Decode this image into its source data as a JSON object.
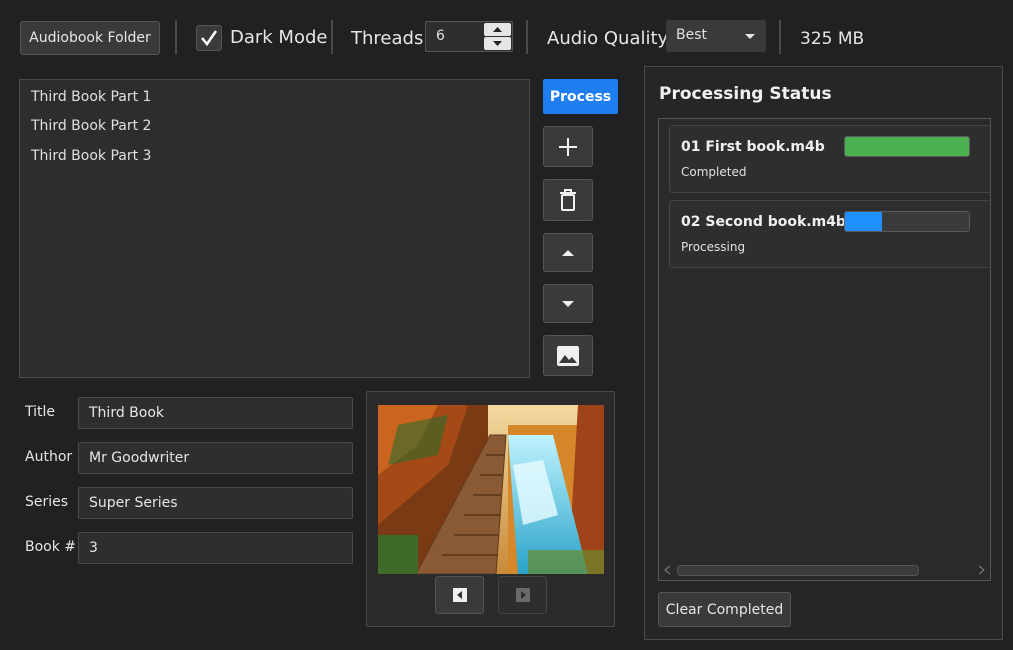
{
  "toolbar": {
    "folder_button": "Audiobook Folder",
    "dark_mode_label": "Dark Mode",
    "dark_mode_checked": true,
    "threads_label": "Threads",
    "threads_value": "6",
    "audio_quality_label": "Audio Quality",
    "audio_quality_value": "Best",
    "size_label": "325 MB"
  },
  "file_list": {
    "items": [
      "Third Book Part 1",
      "Third Book Part 2",
      "Third Book Part 3"
    ]
  },
  "actions": {
    "process_label": "Process",
    "add_icon": "plus-icon",
    "delete_icon": "trash-icon",
    "move_up_icon": "arrow-up-icon",
    "move_down_icon": "arrow-down-icon",
    "image_icon": "image-icon"
  },
  "metadata": {
    "title_label": "Title",
    "title_value": "Third Book",
    "author_label": "Author",
    "author_value": "Mr Goodwriter",
    "series_label": "Series",
    "series_value": "Super Series",
    "book_label": "Book #",
    "book_value": "3"
  },
  "processing": {
    "heading": "Processing Status",
    "jobs": [
      {
        "name": "01 First book.m4b",
        "status": "Completed",
        "progress": 1.0,
        "color": "#4caf50"
      },
      {
        "name": "02 Second book.m4b",
        "status": "Processing",
        "progress": 0.3,
        "color": "#1e90ff"
      }
    ],
    "clear_label": "Clear Completed"
  },
  "colors": {
    "accent": "#1e7ef0",
    "background": "#212121"
  }
}
